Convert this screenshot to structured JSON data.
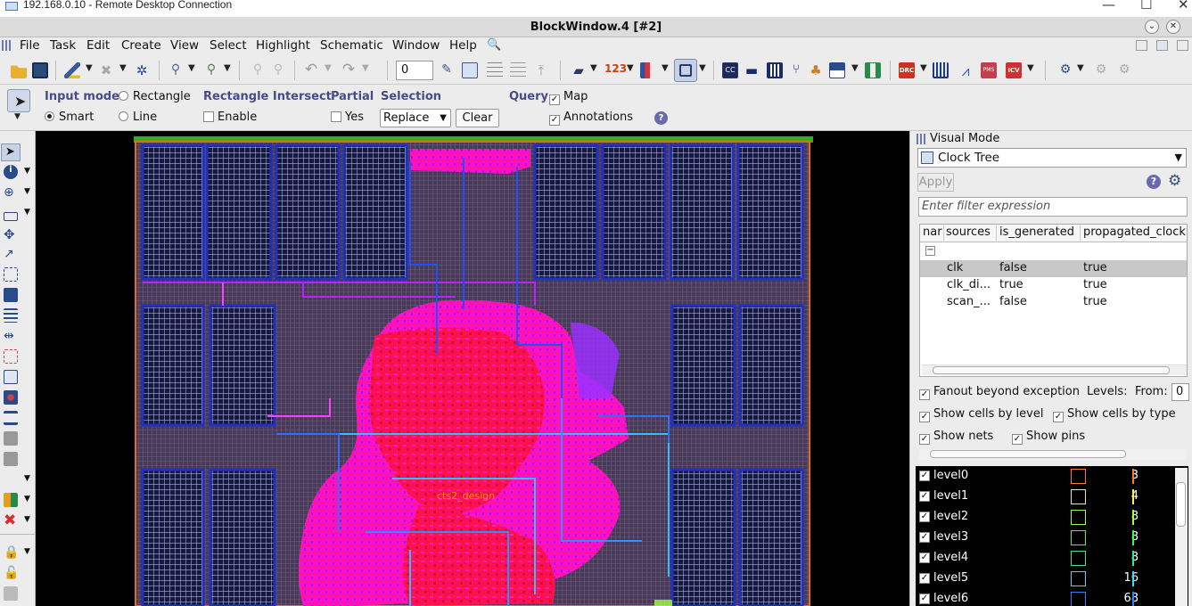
{
  "rdp": {
    "title": "192.168.0.10 - Remote Desktop Connection",
    "min": "—",
    "max": "☐",
    "close": "✕"
  },
  "window": {
    "title": "BlockWindow.4 [#2]"
  },
  "menu": [
    "File",
    "Task",
    "Edit",
    "Create",
    "View",
    "Select",
    "Highlight",
    "Schematic",
    "Window",
    "Help"
  ],
  "toolbar": {
    "spinner_value": "0"
  },
  "options": {
    "input_mode_label": "Input mode",
    "rectangle": "Rectangle",
    "smart": "Smart",
    "line": "Line",
    "rect_intersect_label": "Rectangle Intersect",
    "enable": "Enable",
    "partial_label": "Partial",
    "yes": "Yes",
    "selection_label": "Selection",
    "selection_value": "Replace",
    "clear": "Clear",
    "query_label": "Query",
    "map": "Map",
    "annotations": "Annotations"
  },
  "layout": {
    "block_label": "cts2_design"
  },
  "panel": {
    "visual_mode": "Visual Mode",
    "mode_value": "Clock Tree",
    "apply": "Apply",
    "filter_placeholder": "Enter filter expression",
    "columns": [
      "nar",
      "sources",
      "is_generated",
      "propagated_clock"
    ],
    "rows": [
      {
        "name": "clk",
        "is_generated": "false",
        "propagated": "true"
      },
      {
        "name": "clk_di...",
        "is_generated": "true",
        "propagated": "true"
      },
      {
        "name": "scan_...",
        "is_generated": "false",
        "propagated": "true"
      }
    ],
    "fanout": "Fanout beyond exception",
    "levels_label": "Levels:",
    "from_label": "From:",
    "from_value": "0",
    "show_cells_level": "Show cells by level",
    "show_cells_type": "Show cells by type",
    "show_nets": "Show nets",
    "show_pins": "Show pins",
    "levels": [
      {
        "name": "level0",
        "count": "3",
        "color": "#ff7a30"
      },
      {
        "name": "level1",
        "count": "4",
        "color": "#ffee40"
      },
      {
        "name": "level2",
        "count": "8",
        "color": "#a8ff30"
      },
      {
        "name": "level3",
        "count": "8",
        "color": "#30ff50"
      },
      {
        "name": "level4",
        "count": "8",
        "color": "#30e8a0"
      },
      {
        "name": "level5",
        "count": "16",
        "color": "#30e0ff"
      },
      {
        "name": "level6",
        "count": "68",
        "color": "#3080ff"
      }
    ]
  }
}
